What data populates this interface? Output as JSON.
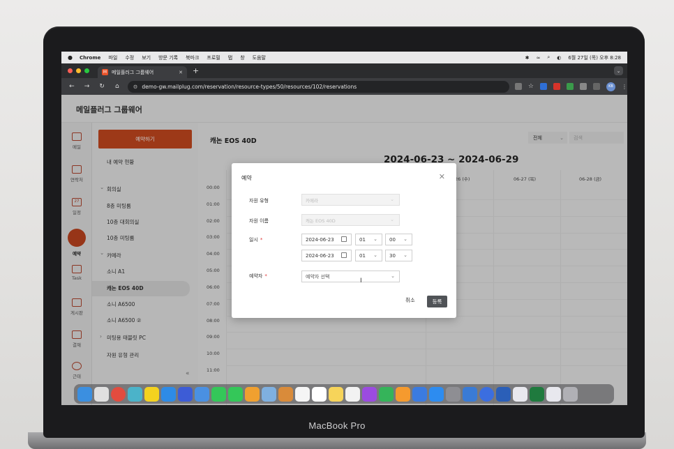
{
  "device": {
    "label": "MacBook Pro"
  },
  "mac_menubar": {
    "app_name": "Chrome",
    "menus": [
      "파일",
      "수정",
      "보기",
      "방문 기록",
      "북마크",
      "프로필",
      "탭",
      "창",
      "도움말"
    ],
    "clock": "6월 27일 (목) 오후 8:28"
  },
  "browser": {
    "tab_title": "메일플러그 그룹웨어",
    "tab_close": "✕",
    "new_tab": "+",
    "url": "demo-gw.mailplug.com/reservation/resource-types/50/resources/102/reservations",
    "profile_initials": "KB"
  },
  "app": {
    "title": "메일플러그 그룹웨어",
    "rail": [
      {
        "label": "메일",
        "icon": "mail-icon"
      },
      {
        "label": "연락처",
        "icon": "contacts-icon"
      },
      {
        "label": "일정",
        "icon": "calendar-icon",
        "icon_text": "27"
      },
      {
        "label": "예약",
        "icon": "reservation-icon"
      },
      {
        "label": "Task",
        "icon": "task-icon"
      },
      {
        "label": "게시판",
        "icon": "board-icon"
      },
      {
        "label": "결재",
        "icon": "approval-icon"
      },
      {
        "label": "근태",
        "icon": "attendance-icon"
      }
    ],
    "sidebar": {
      "reserve_button": "예약하기",
      "my_reservations": "내 예약 현황",
      "group_meeting": "회의실",
      "rooms": [
        "8층 미팅룸",
        "10층 대회의실",
        "10층 미팅룸"
      ],
      "group_camera": "카메라",
      "cameras": [
        "소니 A1",
        "캐논 EOS 40D",
        "소니 A6500",
        "소니 A6500 ②"
      ],
      "tablet_group": "미팅용 태블릿 PC",
      "manage": "자원 유형 관리",
      "collapse": "«",
      "chevron_down": "⌄",
      "chevron_right": "›"
    },
    "main": {
      "resource_title": "캐논 EOS 40D",
      "filter_value": "전체",
      "search_placeholder": "검색",
      "date_range": "2024-06-23 ~ 2024-06-29",
      "day_headers": [
        "26 (수)",
        "06-27 (목)",
        "06-28 (금)"
      ],
      "times": [
        "00:00",
        "01:00",
        "02:00",
        "03:00",
        "04:00",
        "05:00",
        "06:00",
        "07:00",
        "08:00",
        "09:00",
        "10:00",
        "11:00"
      ]
    }
  },
  "dialog": {
    "title": "예약",
    "close": "✕",
    "resource_type_label": "자원 유형",
    "resource_type_value": "카메라",
    "resource_name_label": "자원 이름",
    "resource_name_value": "캐논 EOS 40D",
    "datetime_label": "일시",
    "required_mark": "*",
    "start_date": "2024-06-23",
    "start_hour": "01",
    "start_minute": "00",
    "end_date": "2024-06-23",
    "end_hour": "01",
    "end_minute": "30",
    "booker_label": "예약자",
    "booker_placeholder": "예약자 선택",
    "cancel": "취소",
    "submit": "등록",
    "chevron": "⌄"
  }
}
